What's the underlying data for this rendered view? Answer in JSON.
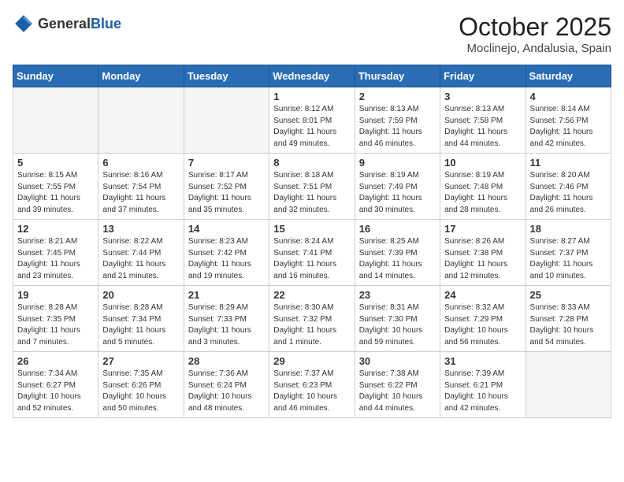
{
  "header": {
    "logo_general": "General",
    "logo_blue": "Blue",
    "month": "October 2025",
    "location": "Moclinejo, Andalusia, Spain"
  },
  "days_of_week": [
    "Sunday",
    "Monday",
    "Tuesday",
    "Wednesday",
    "Thursday",
    "Friday",
    "Saturday"
  ],
  "weeks": [
    [
      {
        "day": "",
        "sunrise": "",
        "sunset": "",
        "daylight": "",
        "empty": true
      },
      {
        "day": "",
        "sunrise": "",
        "sunset": "",
        "daylight": "",
        "empty": true
      },
      {
        "day": "",
        "sunrise": "",
        "sunset": "",
        "daylight": "",
        "empty": true
      },
      {
        "day": "1",
        "sunrise": "Sunrise: 8:12 AM",
        "sunset": "Sunset: 8:01 PM",
        "daylight": "Daylight: 11 hours and 49 minutes.",
        "empty": false
      },
      {
        "day": "2",
        "sunrise": "Sunrise: 8:13 AM",
        "sunset": "Sunset: 7:59 PM",
        "daylight": "Daylight: 11 hours and 46 minutes.",
        "empty": false
      },
      {
        "day": "3",
        "sunrise": "Sunrise: 8:13 AM",
        "sunset": "Sunset: 7:58 PM",
        "daylight": "Daylight: 11 hours and 44 minutes.",
        "empty": false
      },
      {
        "day": "4",
        "sunrise": "Sunrise: 8:14 AM",
        "sunset": "Sunset: 7:56 PM",
        "daylight": "Daylight: 11 hours and 42 minutes.",
        "empty": false
      }
    ],
    [
      {
        "day": "5",
        "sunrise": "Sunrise: 8:15 AM",
        "sunset": "Sunset: 7:55 PM",
        "daylight": "Daylight: 11 hours and 39 minutes.",
        "empty": false
      },
      {
        "day": "6",
        "sunrise": "Sunrise: 8:16 AM",
        "sunset": "Sunset: 7:54 PM",
        "daylight": "Daylight: 11 hours and 37 minutes.",
        "empty": false
      },
      {
        "day": "7",
        "sunrise": "Sunrise: 8:17 AM",
        "sunset": "Sunset: 7:52 PM",
        "daylight": "Daylight: 11 hours and 35 minutes.",
        "empty": false
      },
      {
        "day": "8",
        "sunrise": "Sunrise: 8:18 AM",
        "sunset": "Sunset: 7:51 PM",
        "daylight": "Daylight: 11 hours and 32 minutes.",
        "empty": false
      },
      {
        "day": "9",
        "sunrise": "Sunrise: 8:19 AM",
        "sunset": "Sunset: 7:49 PM",
        "daylight": "Daylight: 11 hours and 30 minutes.",
        "empty": false
      },
      {
        "day": "10",
        "sunrise": "Sunrise: 8:19 AM",
        "sunset": "Sunset: 7:48 PM",
        "daylight": "Daylight: 11 hours and 28 minutes.",
        "empty": false
      },
      {
        "day": "11",
        "sunrise": "Sunrise: 8:20 AM",
        "sunset": "Sunset: 7:46 PM",
        "daylight": "Daylight: 11 hours and 26 minutes.",
        "empty": false
      }
    ],
    [
      {
        "day": "12",
        "sunrise": "Sunrise: 8:21 AM",
        "sunset": "Sunset: 7:45 PM",
        "daylight": "Daylight: 11 hours and 23 minutes.",
        "empty": false
      },
      {
        "day": "13",
        "sunrise": "Sunrise: 8:22 AM",
        "sunset": "Sunset: 7:44 PM",
        "daylight": "Daylight: 11 hours and 21 minutes.",
        "empty": false
      },
      {
        "day": "14",
        "sunrise": "Sunrise: 8:23 AM",
        "sunset": "Sunset: 7:42 PM",
        "daylight": "Daylight: 11 hours and 19 minutes.",
        "empty": false
      },
      {
        "day": "15",
        "sunrise": "Sunrise: 8:24 AM",
        "sunset": "Sunset: 7:41 PM",
        "daylight": "Daylight: 11 hours and 16 minutes.",
        "empty": false
      },
      {
        "day": "16",
        "sunrise": "Sunrise: 8:25 AM",
        "sunset": "Sunset: 7:39 PM",
        "daylight": "Daylight: 11 hours and 14 minutes.",
        "empty": false
      },
      {
        "day": "17",
        "sunrise": "Sunrise: 8:26 AM",
        "sunset": "Sunset: 7:38 PM",
        "daylight": "Daylight: 11 hours and 12 minutes.",
        "empty": false
      },
      {
        "day": "18",
        "sunrise": "Sunrise: 8:27 AM",
        "sunset": "Sunset: 7:37 PM",
        "daylight": "Daylight: 11 hours and 10 minutes.",
        "empty": false
      }
    ],
    [
      {
        "day": "19",
        "sunrise": "Sunrise: 8:28 AM",
        "sunset": "Sunset: 7:35 PM",
        "daylight": "Daylight: 11 hours and 7 minutes.",
        "empty": false
      },
      {
        "day": "20",
        "sunrise": "Sunrise: 8:28 AM",
        "sunset": "Sunset: 7:34 PM",
        "daylight": "Daylight: 11 hours and 5 minutes.",
        "empty": false
      },
      {
        "day": "21",
        "sunrise": "Sunrise: 8:29 AM",
        "sunset": "Sunset: 7:33 PM",
        "daylight": "Daylight: 11 hours and 3 minutes.",
        "empty": false
      },
      {
        "day": "22",
        "sunrise": "Sunrise: 8:30 AM",
        "sunset": "Sunset: 7:32 PM",
        "daylight": "Daylight: 11 hours and 1 minute.",
        "empty": false
      },
      {
        "day": "23",
        "sunrise": "Sunrise: 8:31 AM",
        "sunset": "Sunset: 7:30 PM",
        "daylight": "Daylight: 10 hours and 59 minutes.",
        "empty": false
      },
      {
        "day": "24",
        "sunrise": "Sunrise: 8:32 AM",
        "sunset": "Sunset: 7:29 PM",
        "daylight": "Daylight: 10 hours and 56 minutes.",
        "empty": false
      },
      {
        "day": "25",
        "sunrise": "Sunrise: 8:33 AM",
        "sunset": "Sunset: 7:28 PM",
        "daylight": "Daylight: 10 hours and 54 minutes.",
        "empty": false
      }
    ],
    [
      {
        "day": "26",
        "sunrise": "Sunrise: 7:34 AM",
        "sunset": "Sunset: 6:27 PM",
        "daylight": "Daylight: 10 hours and 52 minutes.",
        "empty": false
      },
      {
        "day": "27",
        "sunrise": "Sunrise: 7:35 AM",
        "sunset": "Sunset: 6:26 PM",
        "daylight": "Daylight: 10 hours and 50 minutes.",
        "empty": false
      },
      {
        "day": "28",
        "sunrise": "Sunrise: 7:36 AM",
        "sunset": "Sunset: 6:24 PM",
        "daylight": "Daylight: 10 hours and 48 minutes.",
        "empty": false
      },
      {
        "day": "29",
        "sunrise": "Sunrise: 7:37 AM",
        "sunset": "Sunset: 6:23 PM",
        "daylight": "Daylight: 10 hours and 46 minutes.",
        "empty": false
      },
      {
        "day": "30",
        "sunrise": "Sunrise: 7:38 AM",
        "sunset": "Sunset: 6:22 PM",
        "daylight": "Daylight: 10 hours and 44 minutes.",
        "empty": false
      },
      {
        "day": "31",
        "sunrise": "Sunrise: 7:39 AM",
        "sunset": "Sunset: 6:21 PM",
        "daylight": "Daylight: 10 hours and 42 minutes.",
        "empty": false
      },
      {
        "day": "",
        "sunrise": "",
        "sunset": "",
        "daylight": "",
        "empty": true
      }
    ]
  ]
}
